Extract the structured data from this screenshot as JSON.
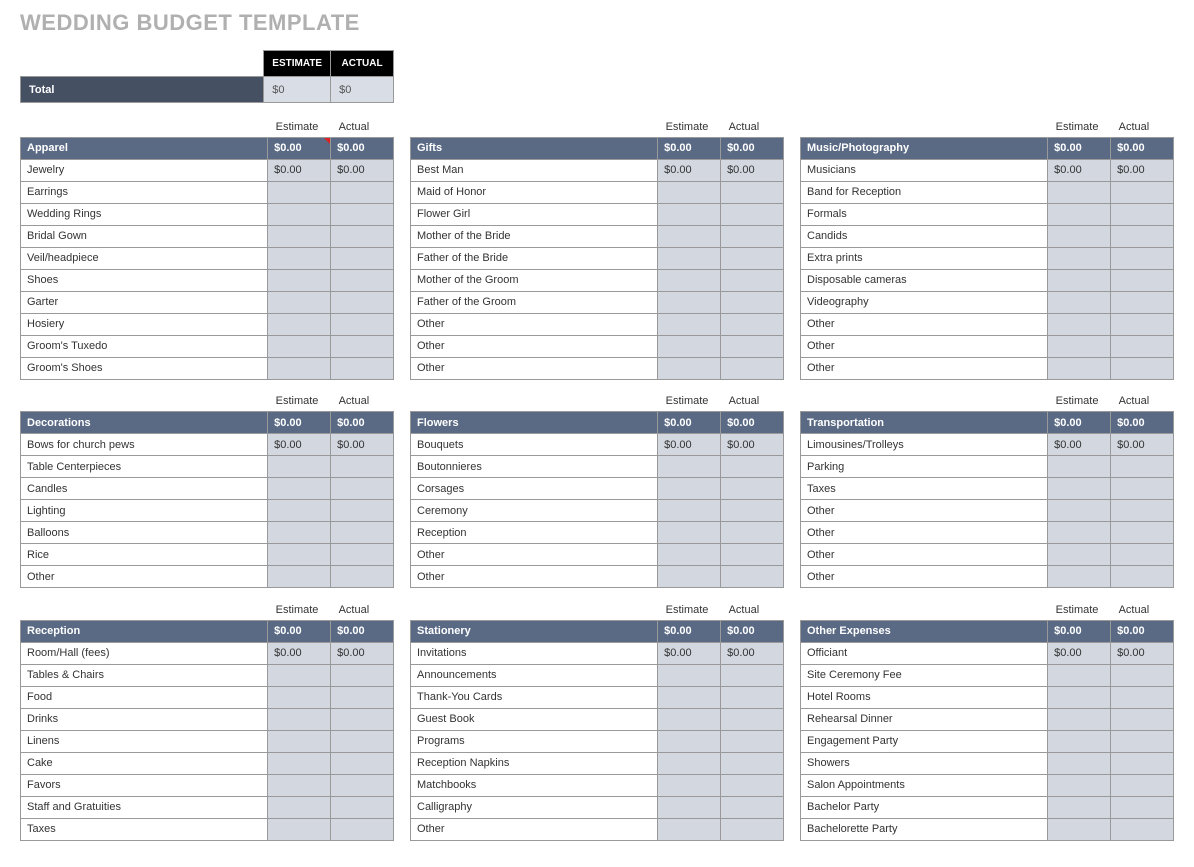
{
  "title": "WEDDING BUDGET TEMPLATE",
  "labels": {
    "estimate_caps": "ESTIMATE",
    "actual_caps": "ACTUAL",
    "estimate": "Estimate",
    "actual": "Actual",
    "total": "Total"
  },
  "totals": {
    "estimate": "$0",
    "actual": "$0"
  },
  "zero": "$0.00",
  "columns": [
    [
      {
        "name": "Apparel",
        "estimate": "$0.00",
        "actual": "$0.00",
        "first_est": "$0.00",
        "first_act": "$0.00",
        "redmark": true,
        "items": [
          "Jewelry",
          "Earrings",
          "Wedding Rings",
          "Bridal Gown",
          "Veil/headpiece",
          "Shoes",
          "Garter",
          "Hosiery",
          "Groom's Tuxedo",
          "Groom's Shoes"
        ]
      },
      {
        "name": "Decorations",
        "estimate": "$0.00",
        "actual": "$0.00",
        "first_est": "$0.00",
        "first_act": "$0.00",
        "items": [
          "Bows for church pews",
          "Table Centerpieces",
          "Candles",
          "Lighting",
          "Balloons",
          "Rice",
          "Other"
        ]
      },
      {
        "name": "Reception",
        "estimate": "$0.00",
        "actual": "$0.00",
        "first_est": "$0.00",
        "first_act": "$0.00",
        "items": [
          "Room/Hall (fees)",
          "Tables & Chairs",
          "Food",
          "Drinks",
          "Linens",
          "Cake",
          "Favors",
          "Staff and Gratuities",
          "Taxes"
        ]
      }
    ],
    [
      {
        "name": "Gifts",
        "estimate": "$0.00",
        "actual": "$0.00",
        "first_est": "$0.00",
        "first_act": "$0.00",
        "items": [
          "Best Man",
          "Maid of Honor",
          "Flower Girl",
          "Mother of the Bride",
          "Father of the Bride",
          "Mother of the Groom",
          "Father of the Groom",
          "Other",
          "Other",
          "Other"
        ]
      },
      {
        "name": "Flowers",
        "estimate": "$0.00",
        "actual": "$0.00",
        "first_est": "$0.00",
        "first_act": "$0.00",
        "items": [
          "Bouquets",
          "Boutonnieres",
          "Corsages",
          "Ceremony",
          "Reception",
          "Other",
          "Other"
        ]
      },
      {
        "name": "Stationery",
        "estimate": "$0.00",
        "actual": "$0.00",
        "first_est": "$0.00",
        "first_act": "$0.00",
        "items": [
          "Invitations",
          "Announcements",
          "Thank-You Cards",
          "Guest Book",
          "Programs",
          "Reception Napkins",
          "Matchbooks",
          "Calligraphy",
          "Other"
        ]
      }
    ],
    [
      {
        "name": "Music/Photography",
        "estimate": "$0.00",
        "actual": "$0.00",
        "first_est": "$0.00",
        "first_act": "$0.00",
        "items": [
          "Musicians",
          "Band for Reception",
          "Formals",
          "Candids",
          "Extra prints",
          "Disposable cameras",
          "Videography",
          "Other",
          "Other",
          "Other"
        ]
      },
      {
        "name": "Transportation",
        "estimate": "$0.00",
        "actual": "$0.00",
        "first_est": "$0.00",
        "first_act": "$0.00",
        "items": [
          "Limousines/Trolleys",
          "Parking",
          "Taxes",
          "Other",
          "Other",
          "Other",
          "Other"
        ]
      },
      {
        "name": "Other Expenses",
        "estimate": "$0.00",
        "actual": "$0.00",
        "first_est": "$0.00",
        "first_act": "$0.00",
        "items": [
          "Officiant",
          "Site Ceremony Fee",
          "Hotel Rooms",
          "Rehearsal Dinner",
          "Engagement Party",
          "Showers",
          "Salon Appointments",
          "Bachelor Party",
          "Bachelorette Party"
        ]
      }
    ]
  ]
}
